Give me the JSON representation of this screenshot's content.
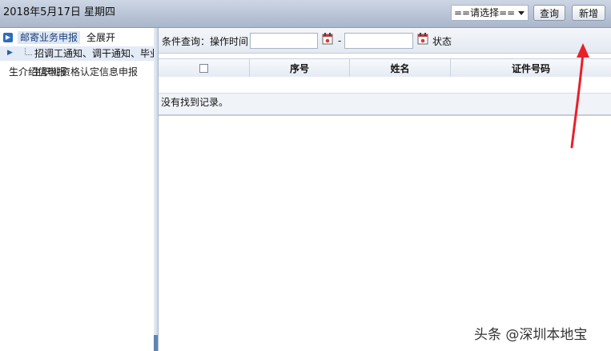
{
  "header": {
    "date_text": "2018年5月17日 星期四"
  },
  "sidebar": {
    "root_label": "邮寄业务申报",
    "expand_all_label": "全展开",
    "child_label": "招调工通知、调干通知、毕业",
    "item_label": "生介绍信申报",
    "overlap_text": "生职业资格认定信息申报"
  },
  "toolbar": {
    "condition_label": "条件查询：操作时间",
    "start_date_value": "",
    "dash": "-",
    "end_date_value": "",
    "status_label": "状态",
    "status_selected": "==请选择==",
    "query_label": "查询",
    "add_label": "新增"
  },
  "grid": {
    "columns": [
      "",
      "序号",
      "姓名",
      "证件号码"
    ],
    "empty_message": "没有找到记录。"
  },
  "watermark": "头条 @深圳本地宝",
  "colors": {
    "annotation_arrow": "#e8202a",
    "header_bg": "#b9c4d6",
    "selected_bg": "#e3ebf7"
  }
}
